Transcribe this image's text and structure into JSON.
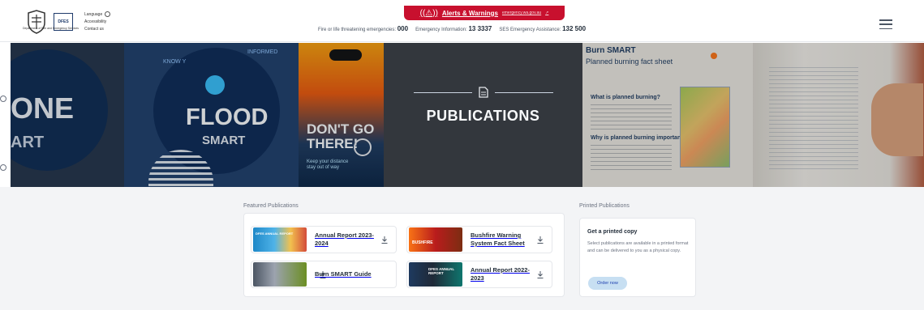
{
  "header": {
    "logo_caption": "Department of Fire and Emergency Services",
    "dfes_abbr": "DFES",
    "links": [
      "Language",
      "Accessibility",
      "Contact us"
    ],
    "alert": {
      "title": "Alerts & Warnings",
      "url": "emergency.wa.gov.au",
      "color": "#c8102e"
    },
    "contacts": [
      {
        "label": "Fire or life threatening emergencies:",
        "number": "000"
      },
      {
        "label": "Emergency Information:",
        "number": "13 3337"
      },
      {
        "label": "SES Emergency Assistance:",
        "number": "132 500"
      }
    ],
    "menu_icon": "hamburger-menu-icon"
  },
  "hero": {
    "title": "PUBLICATIONS",
    "background_panels": {
      "one_smart": [
        "ONE",
        "ART"
      ],
      "flood": {
        "line1": "FLOOD",
        "line2": "SMART",
        "arc_left": "KNOW Y",
        "arc_right": "INFORMED"
      },
      "dont_go": {
        "line1": "DON'T GO",
        "line2": "THERE!",
        "small": "Keep your distance stay out of way"
      },
      "burn_sheet": {
        "title": "Burn SMART",
        "subtitle": "Planned burning fact sheet",
        "q1": "What is planned burning?",
        "q2": "Why is planned burning important?"
      }
    }
  },
  "featured": {
    "label": "Featured Publications",
    "items": [
      {
        "title": "Annual Report 2023-2024",
        "thumb_label": "DFES ANNUAL REPORT"
      },
      {
        "title": "Bushfire Warning System Fact Sheet",
        "thumb_label": "BUSHFIRE"
      },
      {
        "title": "Burn SMART Guide",
        "thumb_label": ""
      },
      {
        "title": "Annual Report 2022-2023",
        "thumb_label": "DFES ANNUAL REPORT"
      }
    ]
  },
  "printed": {
    "label": "Printed Publications",
    "title": "Get a printed copy",
    "description": "Select publications are available in a printed format and can be delivered to you as a physical copy.",
    "button": "Order now"
  }
}
